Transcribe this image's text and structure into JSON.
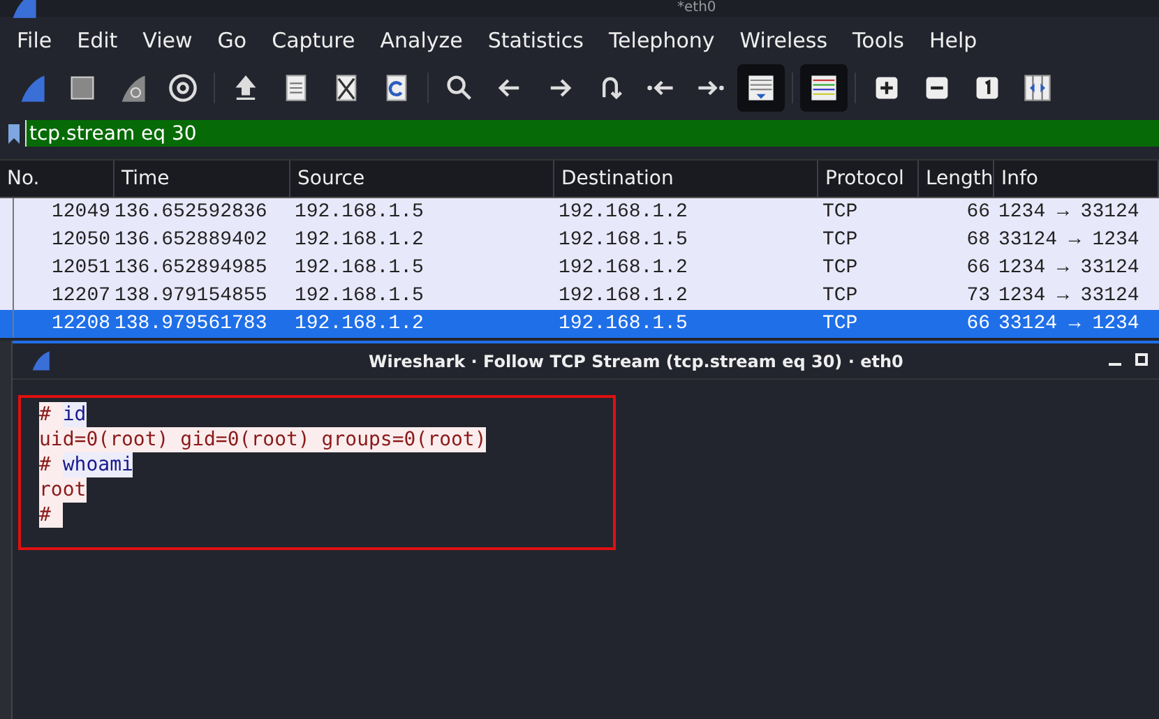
{
  "window": {
    "title": "*eth0"
  },
  "menu": [
    "File",
    "Edit",
    "View",
    "Go",
    "Capture",
    "Analyze",
    "Statistics",
    "Telephony",
    "Wireless",
    "Tools",
    "Help"
  ],
  "toolbar": [
    {
      "kind": "fin",
      "pressed": false
    },
    {
      "kind": "stop",
      "pressed": false
    },
    {
      "kind": "restart",
      "pressed": false
    },
    {
      "kind": "gear",
      "pressed": false
    },
    {
      "kind": "sep"
    },
    {
      "kind": "open",
      "pressed": false
    },
    {
      "kind": "file",
      "pressed": false
    },
    {
      "kind": "closefile",
      "pressed": false
    },
    {
      "kind": "reload",
      "pressed": false
    },
    {
      "kind": "sep"
    },
    {
      "kind": "search",
      "pressed": false
    },
    {
      "kind": "left",
      "pressed": false
    },
    {
      "kind": "right",
      "pressed": false
    },
    {
      "kind": "jump",
      "pressed": false
    },
    {
      "kind": "first",
      "pressed": false
    },
    {
      "kind": "last",
      "pressed": false
    },
    {
      "kind": "autoscroll",
      "pressed": true
    },
    {
      "kind": "sep"
    },
    {
      "kind": "colorize",
      "pressed": true
    },
    {
      "kind": "sep"
    },
    {
      "kind": "zoomin",
      "pressed": false
    },
    {
      "kind": "zoomout",
      "pressed": false
    },
    {
      "kind": "normal",
      "pressed": false
    },
    {
      "kind": "resize",
      "pressed": false
    }
  ],
  "filter": {
    "value": "tcp.stream eq 30"
  },
  "table": {
    "columns": [
      "No.",
      "Time",
      "Source",
      "Destination",
      "Protocol",
      "Length",
      "Info"
    ],
    "rows": [
      {
        "cells": [
          "12049",
          "136.652592836",
          "192.168.1.5",
          "192.168.1.2",
          "TCP",
          "66",
          "1234 → 33124"
        ],
        "selected": false
      },
      {
        "cells": [
          "12050",
          "136.652889402",
          "192.168.1.2",
          "192.168.1.5",
          "TCP",
          "68",
          "33124 → 1234"
        ],
        "selected": false
      },
      {
        "cells": [
          "12051",
          "136.652894985",
          "192.168.1.5",
          "192.168.1.2",
          "TCP",
          "66",
          "1234 → 33124"
        ],
        "selected": false
      },
      {
        "cells": [
          "12207",
          "138.979154855",
          "192.168.1.5",
          "192.168.1.2",
          "TCP",
          "73",
          "1234 → 33124"
        ],
        "selected": false
      },
      {
        "cells": [
          "12208",
          "138.979561783",
          "192.168.1.2",
          "192.168.1.5",
          "TCP",
          "66",
          "33124 → 1234"
        ],
        "selected": true
      }
    ]
  },
  "dialog": {
    "title": "Wireshark · Follow TCP Stream (tcp.stream eq 30) · eth0",
    "stream": [
      [
        {
          "text": "# ",
          "kind": "server"
        },
        {
          "text": "id",
          "kind": "client"
        }
      ],
      [
        {
          "text": "uid=0(root) gid=0(root) groups=0(root)",
          "kind": "server"
        }
      ],
      [
        {
          "text": "# ",
          "kind": "server"
        },
        {
          "text": "whoami",
          "kind": "client"
        }
      ],
      [
        {
          "text": "root",
          "kind": "server"
        }
      ],
      [
        {
          "text": "# ",
          "kind": "server"
        }
      ]
    ]
  }
}
